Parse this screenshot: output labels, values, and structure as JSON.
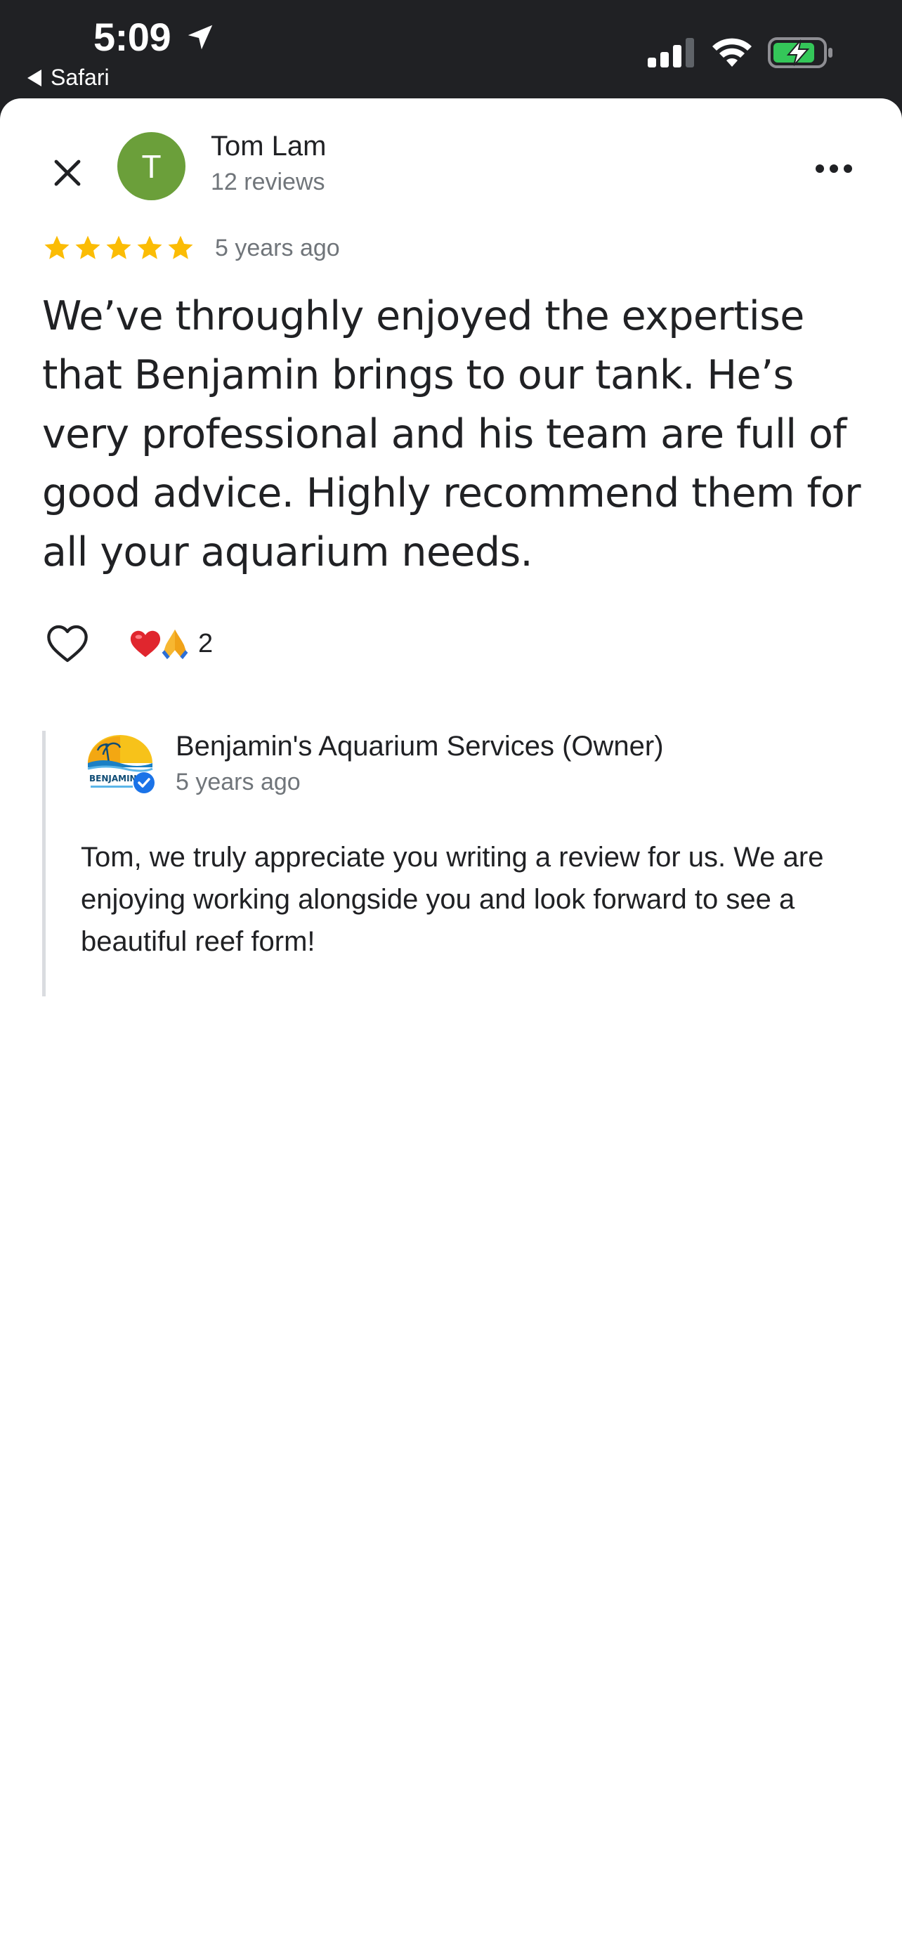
{
  "status_bar": {
    "time": "5:09",
    "back_app": "Safari"
  },
  "review": {
    "reviewer": {
      "initial": "T",
      "name": "Tom Lam",
      "review_count": "12 reviews"
    },
    "rating": 5,
    "rating_max": 5,
    "date": "5 years ago",
    "text": "We’ve throughly enjoyed the expertise that Benjamin brings to our tank. He’s very professional and his team are full of good advice. Highly recommend them for all your aquarium needs.",
    "reactions": {
      "emojis": [
        "red-heart",
        "folded-hands"
      ],
      "count": "2"
    }
  },
  "owner_response": {
    "name": "Benjamin's Aquarium Services (Owner)",
    "date": "5 years ago",
    "text": "Tom, we truly appreciate you writing a review for us. We are enjoying working alongside you and look forward to see a beautiful reef form!",
    "logo_text": "BENJAMIN"
  },
  "colors": {
    "avatar": "#6b9f3a",
    "star": "#fbbc04",
    "verified": "#1a73e8",
    "status_bar_bg": "#202124",
    "battery_fill": "#34c759"
  }
}
